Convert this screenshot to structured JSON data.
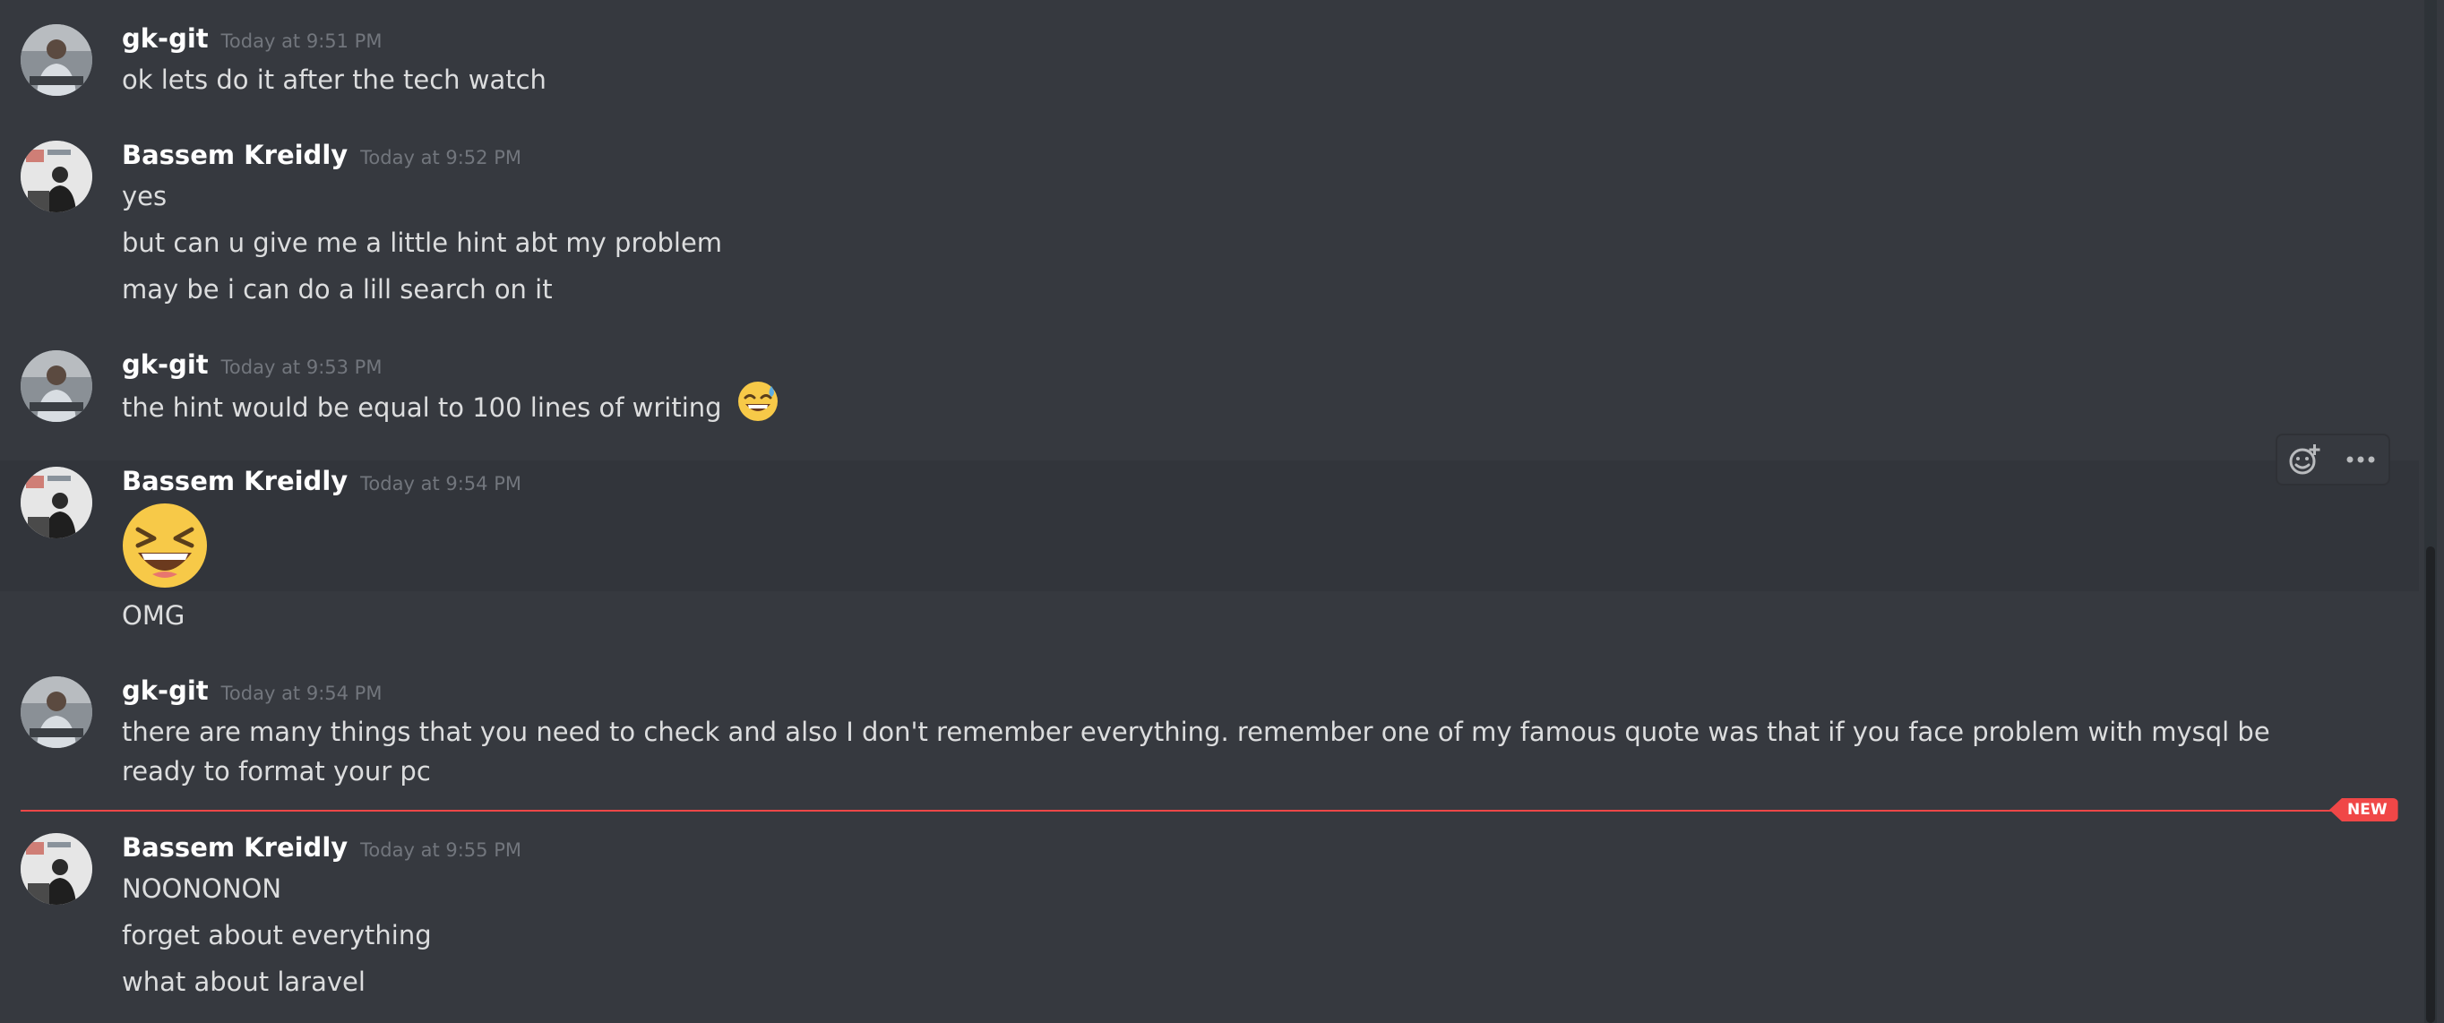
{
  "messages": [
    {
      "author": "gk-git",
      "timestamp": "Today at 9:51 PM",
      "lines": [
        "ok lets do it after the tech watch"
      ]
    },
    {
      "author": "Bassem Kreidly",
      "timestamp": "Today at 9:52 PM",
      "lines": [
        "yes",
        "but can u give me a little hint abt my problem",
        "may be i can do a lill search on it"
      ]
    },
    {
      "author": "gk-git",
      "timestamp": "Today at 9:53 PM",
      "lines": [
        "the hint would be equal to 100 lines of writing"
      ],
      "inline_emoji": "sweat-smile-emoji"
    },
    {
      "author": "Bassem Kreidly",
      "timestamp": "Today at 9:54 PM",
      "big_emoji": "laughing-emoji",
      "lines": [
        "OMG"
      ]
    },
    {
      "author": "gk-git",
      "timestamp": "Today at 9:54 PM",
      "lines": [
        "there are many things that you need to check and also I don't remember everything. remember one of my famous quote was that if you face problem with mysql be ready to format your pc"
      ]
    },
    {
      "author": "Bassem Kreidly",
      "timestamp": "Today at 9:55 PM",
      "lines": [
        "NOONONON",
        "forget about everything",
        "what about laravel"
      ]
    }
  ],
  "new_divider": {
    "label": "NEW"
  },
  "toolbar": {
    "icons": [
      "add-reaction-icon",
      "more-options-icon"
    ]
  },
  "colors": {
    "background": "#36393f",
    "hover_background": "#32353b",
    "author": "#ffffff",
    "timestamp": "#72767d",
    "text": "#dcddde",
    "new_divider": "#f04747"
  }
}
